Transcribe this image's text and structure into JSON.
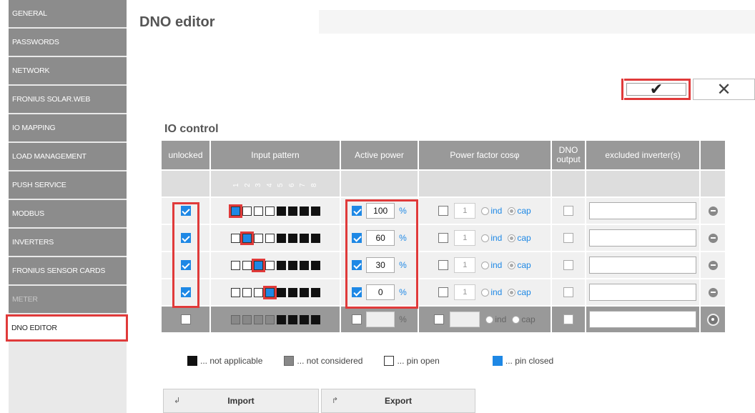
{
  "sidebar": {
    "items": [
      {
        "label": "GENERAL",
        "state": "normal"
      },
      {
        "label": "PASSWORDS",
        "state": "normal"
      },
      {
        "label": "NETWORK",
        "state": "normal"
      },
      {
        "label": "FRONIUS SOLAR.WEB",
        "state": "normal"
      },
      {
        "label": "IO MAPPING",
        "state": "normal"
      },
      {
        "label": "LOAD MANAGEMENT",
        "state": "normal"
      },
      {
        "label": "PUSH SERVICE",
        "state": "normal"
      },
      {
        "label": "MODBUS",
        "state": "normal"
      },
      {
        "label": "INVERTERS",
        "state": "normal"
      },
      {
        "label": "FRONIUS SENSOR CARDS",
        "state": "normal"
      },
      {
        "label": "METER",
        "state": "dim"
      },
      {
        "label": "DNO EDITOR",
        "state": "active"
      }
    ]
  },
  "page": {
    "title": "DNO editor",
    "ok_icon": "checkmark-icon",
    "ok_glyph": "✔",
    "cancel_icon": "close-icon",
    "cancel_glyph": "✕"
  },
  "io_control": {
    "title": "IO control",
    "headers": {
      "unlocked": "unlocked",
      "input_pattern": "Input pattern",
      "active_power": "Active power",
      "power_factor": "Power factor cosφ",
      "dno_output": "DNO output",
      "excluded": "excluded inverter(s)"
    },
    "pin_labels": [
      "1",
      "2",
      "3",
      "4",
      "5",
      "6",
      "7",
      "8"
    ],
    "rows": [
      {
        "unlocked": true,
        "pins": [
          "closed",
          "open",
          "open",
          "open",
          "na",
          "na",
          "na",
          "na"
        ],
        "highlight_pin": 0,
        "power_checked": true,
        "power": "100",
        "unit": "%",
        "pf_checked": false,
        "pf": "1",
        "ind": "ind",
        "cap": "cap",
        "excluded": ""
      },
      {
        "unlocked": true,
        "pins": [
          "open",
          "closed",
          "open",
          "open",
          "na",
          "na",
          "na",
          "na"
        ],
        "highlight_pin": 1,
        "power_checked": true,
        "power": "60",
        "unit": "%",
        "pf_checked": false,
        "pf": "1",
        "ind": "ind",
        "cap": "cap",
        "excluded": ""
      },
      {
        "unlocked": true,
        "pins": [
          "open",
          "open",
          "closed",
          "open",
          "na",
          "na",
          "na",
          "na"
        ],
        "highlight_pin": 2,
        "power_checked": true,
        "power": "30",
        "unit": "%",
        "pf_checked": false,
        "pf": "1",
        "ind": "ind",
        "cap": "cap",
        "excluded": ""
      },
      {
        "unlocked": true,
        "pins": [
          "open",
          "open",
          "open",
          "closed",
          "na",
          "na",
          "na",
          "na"
        ],
        "highlight_pin": 3,
        "power_checked": true,
        "power": "0",
        "unit": "%",
        "pf_checked": false,
        "pf": "1",
        "ind": "ind",
        "cap": "cap",
        "excluded": ""
      }
    ],
    "new_row": {
      "pins": [
        "nc",
        "nc",
        "nc",
        "nc",
        "na",
        "na",
        "na",
        "na"
      ],
      "unit": "%",
      "ind": "ind",
      "cap": "cap"
    }
  },
  "legend": {
    "not_applicable": "... not applicable",
    "not_considered": "... not considered",
    "pin_open": "... pin open",
    "pin_closed": "... pin closed"
  },
  "buttons": {
    "import": "Import",
    "import_icon": "↲",
    "export": "Export",
    "export_icon": "↱"
  },
  "colors": {
    "highlight": "#e03a3a",
    "accent": "#1e88e5",
    "sidebar": "#8c8c8c"
  }
}
